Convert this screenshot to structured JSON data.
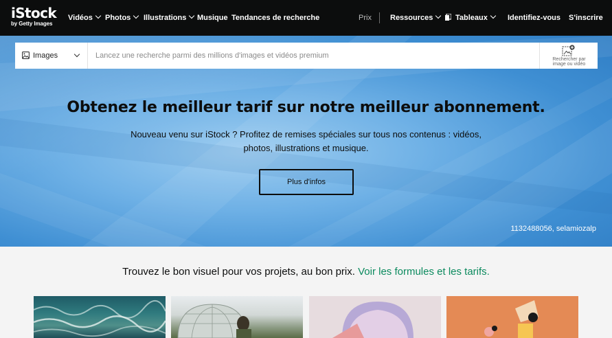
{
  "brand": {
    "name": "iStock",
    "tagline": "by Getty Images"
  },
  "nav": {
    "items": [
      {
        "label": "Vidéos",
        "has_dropdown": true
      },
      {
        "label": "Photos",
        "has_dropdown": true
      },
      {
        "label": "Illustrations",
        "has_dropdown": true
      },
      {
        "label": "Musique",
        "has_dropdown": false
      },
      {
        "label": "Tendances de recherche",
        "has_dropdown": false
      }
    ],
    "prix": "Prix",
    "ressources": "Ressources",
    "tableaux": "Tableaux",
    "login": "Identifiez-vous",
    "signup": "S'inscrire"
  },
  "search": {
    "type_label": "Images",
    "placeholder": "Lancez une recherche parmi des millions d'images et vidéos premium",
    "value": "",
    "visual_search_label_line1": "Rechercher par",
    "visual_search_label_line2": "image ou vidéo"
  },
  "hero": {
    "title": "Obtenez le meilleur tarif sur notre meilleur abonnement.",
    "subtitle_line1": "Nouveau venu sur iStock ? Profitez de remises spéciales sur tous nos contenus : vidéos,",
    "subtitle_line2": "photos, illustrations et musique.",
    "button_label": "Plus d'infos",
    "credit": "1132488056, selamiozalp"
  },
  "promo": {
    "text": "Trouvez le bon visuel pour vos projets, au bon prix.",
    "link": "Voir les formules et les tarifs."
  },
  "colors": {
    "nav_bg": "#0c0d0d",
    "link_green": "#0b8a5e",
    "hero_blue": "#4a97d8"
  },
  "icons": {
    "search_type": "image-icon",
    "visual_search": "camera-search-icon",
    "boards": "boards-icon"
  }
}
